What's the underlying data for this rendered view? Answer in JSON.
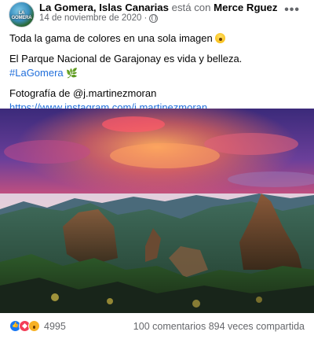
{
  "header": {
    "page_name": "La Gomera, Islas Canarias",
    "connector": "está con",
    "tagged_person": "Merce Rguez",
    "date": "14 de noviembre de 2020",
    "dot": "·",
    "more_label": "•••",
    "avatar_text": "LA GOMERA",
    "privacy_icon": "globe-icon"
  },
  "post": {
    "line1": "Toda la gama de colores en una sola imagen",
    "line2": "El Parque Nacional de Garajonay es vida y belleza.",
    "hashtag": "#LaGomera",
    "line4": "Fotografía de @j.martinezmoran",
    "link": "https://www.instagram.com/j.martinezmoran",
    "emojis": [
      "astonished-face-emoji",
      "herb-emoji"
    ]
  },
  "footer": {
    "reaction_icons": [
      "like-icon",
      "love-icon",
      "wow-icon"
    ],
    "reaction_count": "4995",
    "comments": "100 comentarios",
    "shares": "894 veces compartida"
  },
  "colors": {
    "link": "#216fdb",
    "muted": "#65676b",
    "like": "#1877f2",
    "love": "#f33e58",
    "wow": "#f7b125"
  }
}
